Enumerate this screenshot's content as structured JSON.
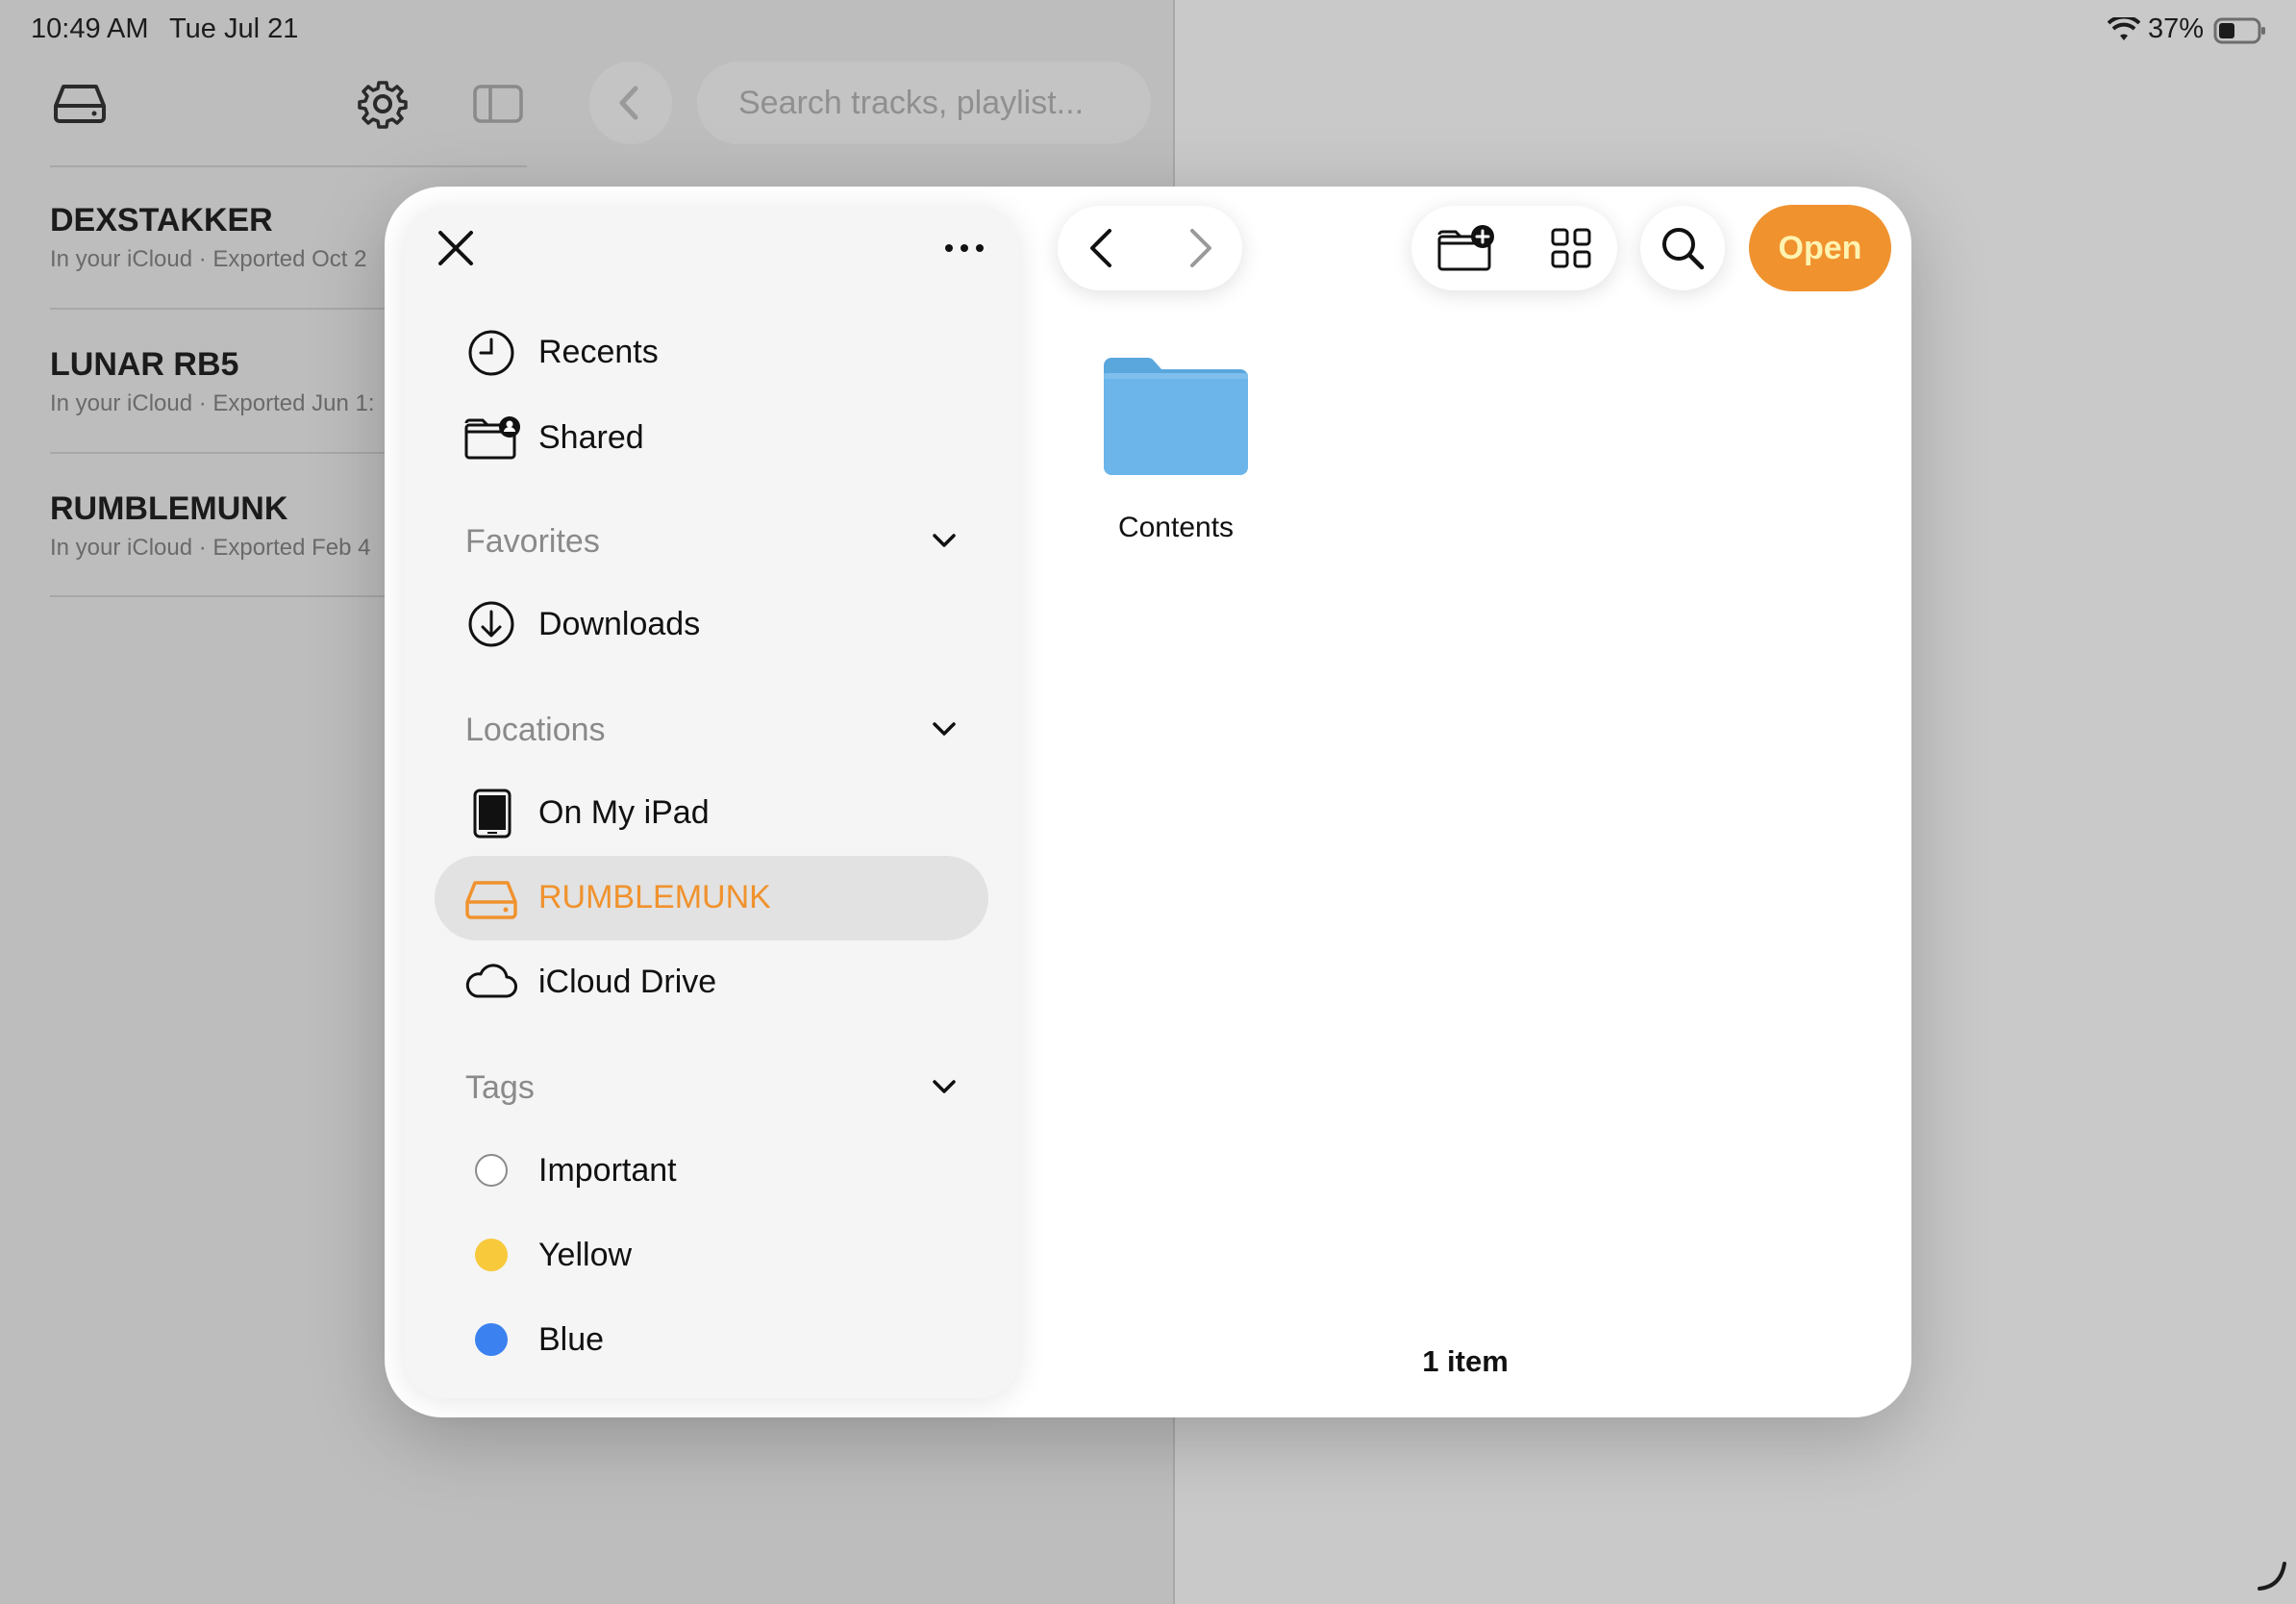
{
  "status_bar": {
    "time": "10:49 AM",
    "date": "Tue Jul 21",
    "battery": "37%"
  },
  "background_app": {
    "search_placeholder": "Search tracks, playlist...",
    "items": [
      {
        "title": "DEXSTAKKER",
        "subtitle": "In your iCloud · Exported Oct 2"
      },
      {
        "title": "LUNAR RB5",
        "subtitle": "In your iCloud · Exported Jun 1:"
      },
      {
        "title": "RUMBLEMUNK",
        "subtitle": "In your iCloud · Exported Feb 4"
      }
    ]
  },
  "picker": {
    "sidebar": {
      "top_items": [
        {
          "label": "Recents",
          "icon": "clock-icon"
        },
        {
          "label": "Shared",
          "icon": "shared-folder-icon"
        }
      ],
      "favorites": {
        "header": "Favorites",
        "items": [
          {
            "label": "Downloads",
            "icon": "download-icon"
          }
        ]
      },
      "locations": {
        "header": "Locations",
        "items": [
          {
            "label": "On My iPad",
            "icon": "ipad-icon"
          },
          {
            "label": "RUMBLEMUNK",
            "icon": "drive-icon",
            "selected": true
          },
          {
            "label": "iCloud Drive",
            "icon": "cloud-icon"
          }
        ]
      },
      "tags": {
        "header": "Tags",
        "items": [
          {
            "label": "Important",
            "color": "#ffffff"
          },
          {
            "label": "Yellow",
            "color": "#f7c93b"
          },
          {
            "label": "Blue",
            "color": "#3b82f0"
          }
        ]
      }
    },
    "toolbar": {
      "open_label": "Open"
    },
    "files": [
      {
        "name": "Contents",
        "kind": "folder"
      }
    ],
    "item_count": "1 item"
  },
  "colors": {
    "accent": "#f0922e",
    "folder": "#6bb5ea"
  }
}
